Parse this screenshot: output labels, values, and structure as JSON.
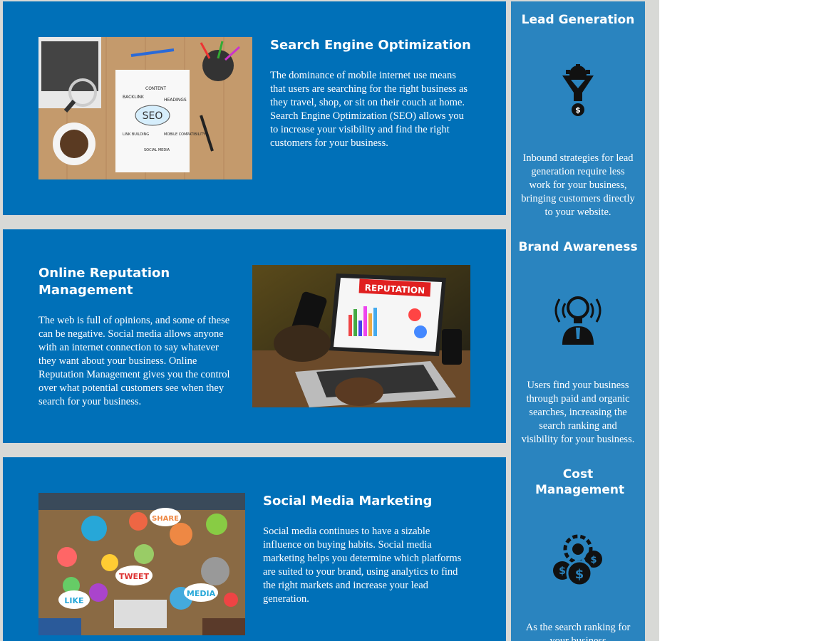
{
  "services": [
    {
      "title": "Search Engine Optimization",
      "body": "The dominance of mobile internet use means that users are searching for the right business as they travel, shop, or sit on their couch at home. Search Engine Optimization (SEO) allows you to increase your visibility and find the right customers for your business.",
      "image": {
        "icon": "seo-notebook-image",
        "words": [
          "CONTENT",
          "BACKLINK",
          "HEADINGS",
          "SEO",
          "LINK BUILDING",
          "MOBILE COMPATIBILITY",
          "SOCIAL MEDIA"
        ]
      }
    },
    {
      "title": "Online Reputation Management",
      "body": "The web is full of opinions, and some of these can be negative. Social media allows anyone with an internet connection to say whatever they want about your business. Online Reputation Management gives you the control over what potential customers see when they search for your business.",
      "image": {
        "icon": "reputation-laptop-image",
        "words": [
          "REPUTATION"
        ]
      }
    },
    {
      "title": "Social Media Marketing",
      "body": "Social media continues to have a sizable influence on buying habits. Social media marketing helps you determine which platforms are suited to your brand, using analytics to find the right markets and increase your lead generation.",
      "image": {
        "icon": "social-media-table-image",
        "words": [
          "SHARE",
          "TWEET",
          "LIKE",
          "MEDIA"
        ]
      }
    }
  ],
  "sidebar": {
    "items": [
      {
        "title": "Lead Generation",
        "icon": "funnel-gear-icon",
        "text": "Inbound strategies for lead generation require less work for your business, bringing customers directly to your website."
      },
      {
        "title": "Brand Awareness",
        "icon": "lightbulb-person-icon",
        "text": "Users find your business through paid and organic searches, increasing the search ranking and visibility for your business."
      },
      {
        "title": "Cost Management",
        "icon": "gear-coins-icon",
        "text": "As the search ranking for your business"
      }
    ]
  },
  "colors": {
    "card": "#0070b8",
    "sidebar": "#2a84bf",
    "page": "#d8d9d6"
  }
}
